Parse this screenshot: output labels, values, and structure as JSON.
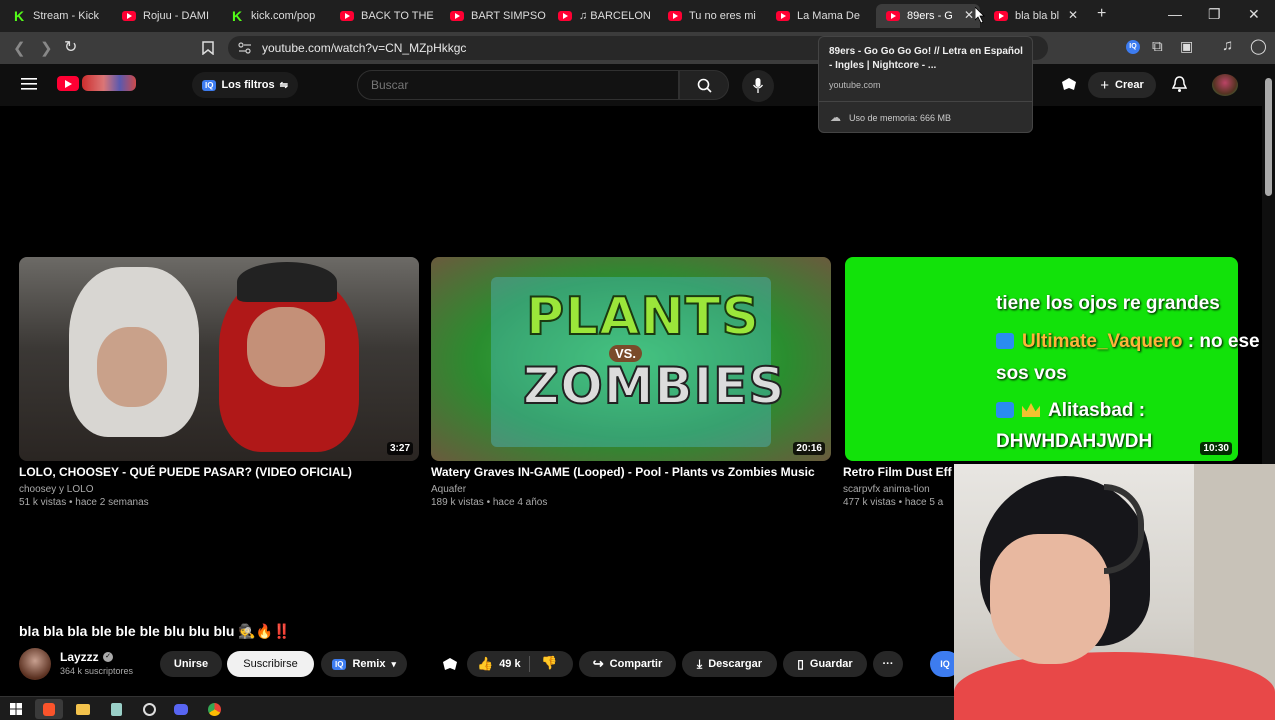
{
  "browser": {
    "tabs": [
      {
        "title": "Stream - Kick",
        "favicon": "kick-icon"
      },
      {
        "title": "Rojuu - DAMI",
        "favicon": "youtube-icon"
      },
      {
        "title": "kick.com/pop",
        "favicon": "kick-icon"
      },
      {
        "title": "BACK TO THE",
        "favicon": "youtube-icon"
      },
      {
        "title": "BART SIMPSO",
        "favicon": "youtube-icon"
      },
      {
        "title": "♫ BARCELON",
        "favicon": "youtube-icon"
      },
      {
        "title": "Tu no eres mi",
        "favicon": "youtube-icon"
      },
      {
        "title": "La Mama De",
        "favicon": "youtube-icon"
      },
      {
        "title": "89ers - G",
        "favicon": "youtube-icon",
        "active": true
      },
      {
        "title": "bla bla bl",
        "favicon": "youtube-icon"
      }
    ],
    "url": "youtube.com/watch?v=CN_MZpHkkgc",
    "hover_card": {
      "title": "89ers - Go Go Go Go! // Letra en Español - Ingles | Nightcore - ...",
      "domain": "youtube.com",
      "memory": "Uso de memoria: 666 MB"
    }
  },
  "youtube": {
    "filters_label": "Los filtros",
    "iq_badge": "IQ",
    "search_placeholder": "Buscar",
    "create_label": "Crear"
  },
  "videos": [
    {
      "title": "LOLO, CHOOSEY - QUÉ PUEDE PASAR? (VIDEO OFICIAL)",
      "channel": "choosey y LOLO",
      "meta": "51 k vistas • hace 2 semanas",
      "duration": "3:27"
    },
    {
      "title": "Watery Graves IN-GAME (Looped) - Pool - Plants vs Zombies Music",
      "channel": "Aquafer",
      "meta": "189 k vistas • hace 4 años",
      "duration": "20:16",
      "thumb_text": {
        "line1": "PLANTS",
        "vs": "VS.",
        "line2": "ZOMBIES"
      }
    },
    {
      "title": "Retro Film Dust Eff",
      "channel": "scarpvfx anima-tion",
      "meta": "477 k vistas • hace 5 a",
      "duration": "10:30"
    }
  ],
  "chat_overlay": {
    "line0": "tiene los ojos re grandes",
    "msg1_user": "Ultimate_Vaquero",
    "msg1_text": " : no ese",
    "msg1_cont": "sos vos",
    "msg2_user": "Alitasbad :",
    "msg2_text": "DHWHDAHJWDH"
  },
  "player": {
    "title": "bla bla bla ble ble ble blu blu blu 🕵️🔥‼️",
    "channel": "Layzzz",
    "subscribers": "364 k suscriptores",
    "join_label": "Unirse",
    "subscribe_label": "Suscribirse",
    "remix_label": "Remix",
    "likes": "49 k",
    "share_label": "Compartir",
    "download_label": "Descargar",
    "save_label": "Guardar",
    "more_label": "···"
  },
  "colors": {
    "youtube_red": "#ff0033",
    "kick_green": "#53fc18",
    "greenscreen": "#12e20a",
    "chat_username": "#ffb43a"
  }
}
